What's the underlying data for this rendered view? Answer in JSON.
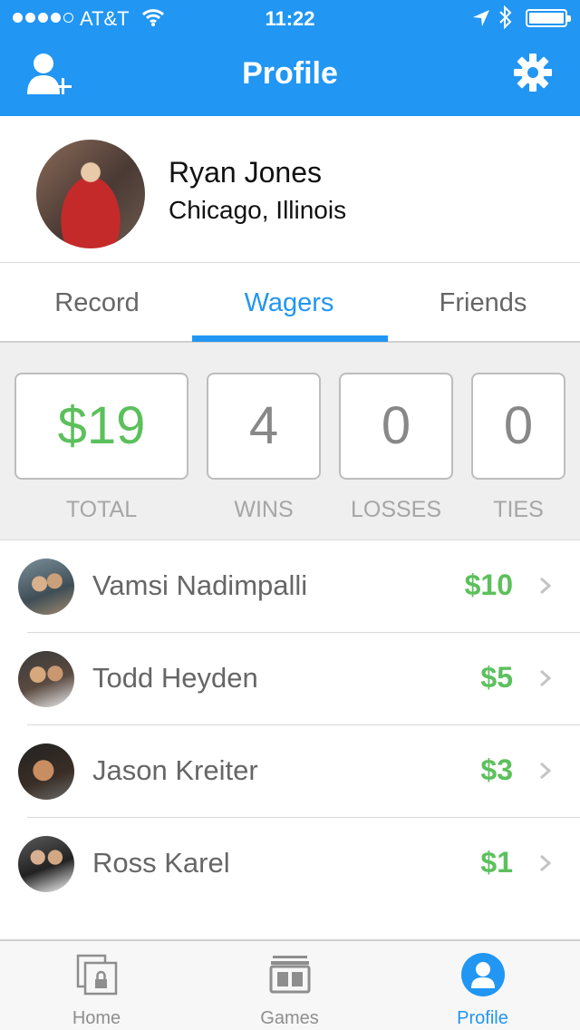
{
  "status_bar": {
    "carrier": "AT&T",
    "time": "11:22"
  },
  "nav": {
    "title": "Profile"
  },
  "profile": {
    "name": "Ryan Jones",
    "location": "Chicago, Illinois"
  },
  "tabs": [
    {
      "label": "Record"
    },
    {
      "label": "Wagers"
    },
    {
      "label": "Friends"
    }
  ],
  "active_tab": "Wagers",
  "stats": {
    "total": {
      "value": "$19",
      "label": "TOTAL"
    },
    "wins": {
      "value": "4",
      "label": "WINS"
    },
    "losses": {
      "value": "0",
      "label": "LOSSES"
    },
    "ties": {
      "value": "0",
      "label": "TIES"
    }
  },
  "wagers": [
    {
      "name": "Vamsi Nadimpalli",
      "amount": "$10"
    },
    {
      "name": "Todd Heyden",
      "amount": "$5"
    },
    {
      "name": "Jason Kreiter",
      "amount": "$3"
    },
    {
      "name": "Ross Karel",
      "amount": "$1"
    }
  ],
  "tab_bar": [
    {
      "label": "Home"
    },
    {
      "label": "Games"
    },
    {
      "label": "Profile"
    }
  ],
  "active_tab_bar": "Profile",
  "colors": {
    "brand": "#2196f3",
    "money": "#5cc05c"
  },
  "icons": [
    "add-friend-icon",
    "gear-icon",
    "chevron-right-icon",
    "home-icon",
    "scoreboard-icon",
    "profile-icon",
    "wifi-icon",
    "location-arrow-icon",
    "bluetooth-icon",
    "battery-icon"
  ]
}
